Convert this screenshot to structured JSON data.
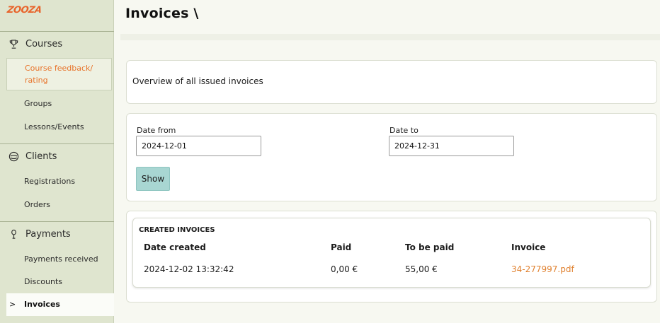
{
  "brand": {
    "logo_text": "ZOOZA",
    "accent": "#e8732a"
  },
  "sidebar": {
    "sections": [
      {
        "label": "Courses",
        "icon": "trophy-icon"
      },
      {
        "label": "Clients",
        "icon": "users-circle-icon"
      },
      {
        "label": "Payments",
        "icon": "coins-icon"
      }
    ],
    "items": [
      {
        "label": "Course feedback/ rating",
        "state": "highlighted"
      },
      {
        "label": "Groups"
      },
      {
        "label": "Lessons/Events"
      },
      {
        "label": "Registrations"
      },
      {
        "label": "Orders"
      },
      {
        "label": "Payments received"
      },
      {
        "label": "Discounts"
      },
      {
        "label": "Invoices",
        "state": "current"
      }
    ],
    "current_marker": ">"
  },
  "header": {
    "title": "Invoices \\"
  },
  "overview": {
    "text": "Overview of all issued invoices"
  },
  "filters": {
    "date_from_label": "Date from",
    "date_from_value": "2024-12-01",
    "date_to_label": "Date to",
    "date_to_value": "2024-12-31",
    "show_label": "Show"
  },
  "invoices": {
    "title": "CREATED INVOICES",
    "columns": [
      "Date created",
      "Paid",
      "To be paid",
      "Invoice"
    ],
    "rows": [
      {
        "date_created": "2024-12-02 13:32:42",
        "paid": "0,00 €",
        "to_be_paid": "55,00 €",
        "invoice": "34-277997.pdf"
      }
    ]
  }
}
